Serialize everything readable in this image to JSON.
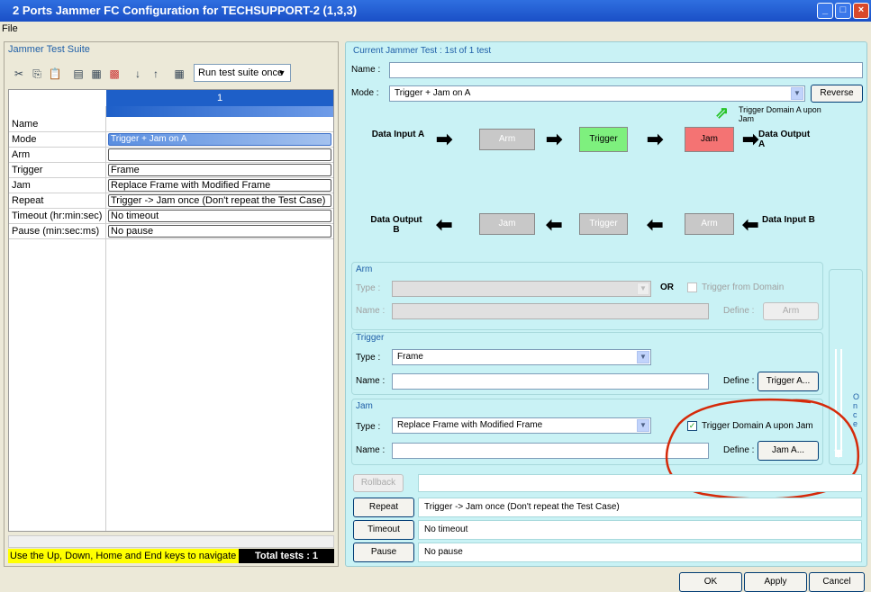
{
  "window": {
    "title": "2 Ports Jammer FC Configuration for TECHSUPPORT-2 (1,3,3)",
    "menu": [
      "File"
    ]
  },
  "left": {
    "group_title": "Jammer Test Suite",
    "run_mode": "Run test suite once",
    "column_header": "1",
    "rows": [
      {
        "label": "Name",
        "value": ""
      },
      {
        "label": "Mode",
        "value": "Trigger + Jam on A"
      },
      {
        "label": "Arm",
        "value": ""
      },
      {
        "label": "Trigger",
        "value": "Frame"
      },
      {
        "label": "Jam",
        "value": "Replace Frame with Modified Frame"
      },
      {
        "label": "Repeat",
        "value": "Trigger -> Jam once (Don't repeat the Test Case)"
      },
      {
        "label": "Timeout (hr:min:sec)",
        "value": "No timeout"
      },
      {
        "label": "Pause (min:sec:ms)",
        "value": "No pause"
      }
    ],
    "status_msg": "Use the Up, Down, Home and End keys to navigate",
    "total_tests": "Total tests : 1"
  },
  "right": {
    "group_title": "Current Jammer Test : 1st of 1 test",
    "name_label": "Name :",
    "name_value": "",
    "mode_label": "Mode :",
    "mode_value": "Trigger + Jam on A",
    "reverse_label": "Reverse",
    "trigger_domain_note": "Trigger Domain A upon Jam",
    "diagram": {
      "in_a": "Data Input A",
      "out_a": "Data Output A",
      "in_b": "Data Input B",
      "out_b": "Data Output B",
      "top": [
        "Arm",
        "Trigger",
        "Jam"
      ],
      "bottom": [
        "Jam",
        "Trigger",
        "Arm"
      ]
    },
    "arm": {
      "title": "Arm",
      "type_label": "Type :",
      "or_label": "OR",
      "trigger_from_domain": "Trigger from Domain",
      "name_label": "Name :",
      "define_label": "Define :",
      "define_btn": "Arm"
    },
    "trigger": {
      "title": "Trigger",
      "type_label": "Type :",
      "type_value": "Frame",
      "name_label": "Name :",
      "define_label": "Define :",
      "define_btn": "Trigger A..."
    },
    "jam": {
      "title": "Jam",
      "type_label": "Type :",
      "type_value": "Replace Frame with Modified Frame",
      "name_label": "Name :",
      "define_label": "Define :",
      "define_btn": "Jam A...",
      "checkbox_label": "Trigger Domain A upon Jam"
    },
    "once_label": "Once",
    "rollback_label": "Rollback",
    "repeat_btn": "Repeat",
    "repeat_value": "Trigger -> Jam once (Don't repeat the Test Case)",
    "timeout_btn": "Timeout",
    "timeout_value": "No timeout",
    "pause_btn": "Pause",
    "pause_value": "No pause"
  },
  "footer": {
    "ok": "OK",
    "apply": "Apply",
    "cancel": "Cancel"
  },
  "colors": {
    "trigger_box": "#7ef07e",
    "jam_box": "#f47373",
    "disabled_box": "#c8c8c8",
    "panel_bg": "#c9f2f5",
    "annotation_circle": "#d52a0a"
  }
}
